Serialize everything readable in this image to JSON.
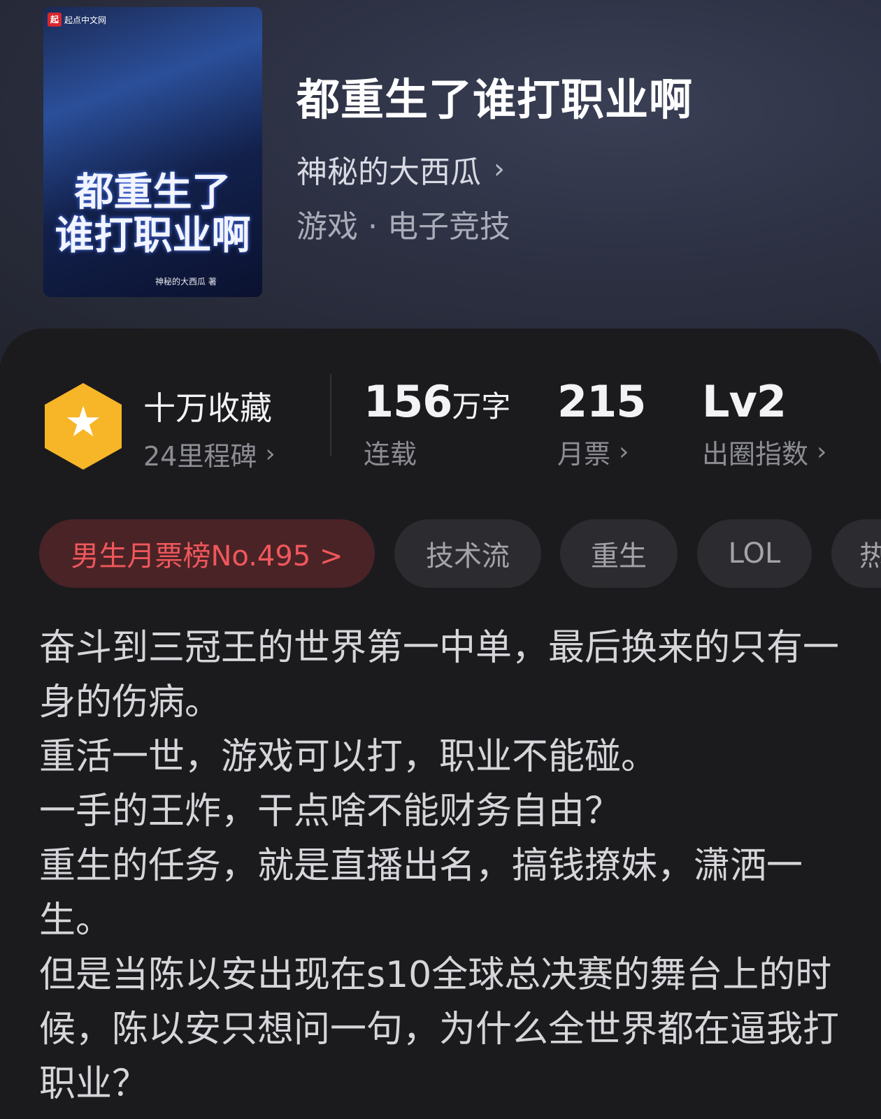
{
  "book": {
    "title": "都重生了谁打职业啊",
    "author": "神秘的大西瓜",
    "genre": "游戏 · 电子竞技",
    "cover": {
      "site_badge": "起点中文网",
      "badge_mark": "起",
      "title_line1": "都重生了",
      "title_line2": "谁打职业啊",
      "author_tag": "神秘的大西瓜 著"
    }
  },
  "stats": {
    "collection": {
      "value": "十万收藏",
      "sub": "24里程碑"
    },
    "words": {
      "number": "156",
      "unit": "万字",
      "sub": "连载"
    },
    "monthly_votes": {
      "number": "215",
      "sub": "月票"
    },
    "influence": {
      "number": "Lv2",
      "sub": "出圈指数"
    }
  },
  "tags": [
    "男生月票榜No.495 >",
    "技术流",
    "重生",
    "LOL",
    "热"
  ],
  "description": [
    "奋斗到三冠王的世界第一中单，最后换来的只有一身的伤病。",
    "重活一世，游戏可以打，职业不能碰。",
    "一手的王炸，干点啥不能财务自由？",
    "重生的任务，就是直播出名，搞钱撩妹，潇洒一生。",
    "但是当陈以安出现在s10全球总决赛的舞台上的时候，陈以安只想问一句，为什么全世界都在逼我打职业？"
  ],
  "colors": {
    "rank_tag_text": "#f0575b",
    "rank_tag_bg": "#4a2326",
    "milestone_hex": "#f7b528",
    "panel_bg": "#1b1b1e"
  },
  "icons": [
    "star-icon",
    "chevron-right-icon"
  ]
}
